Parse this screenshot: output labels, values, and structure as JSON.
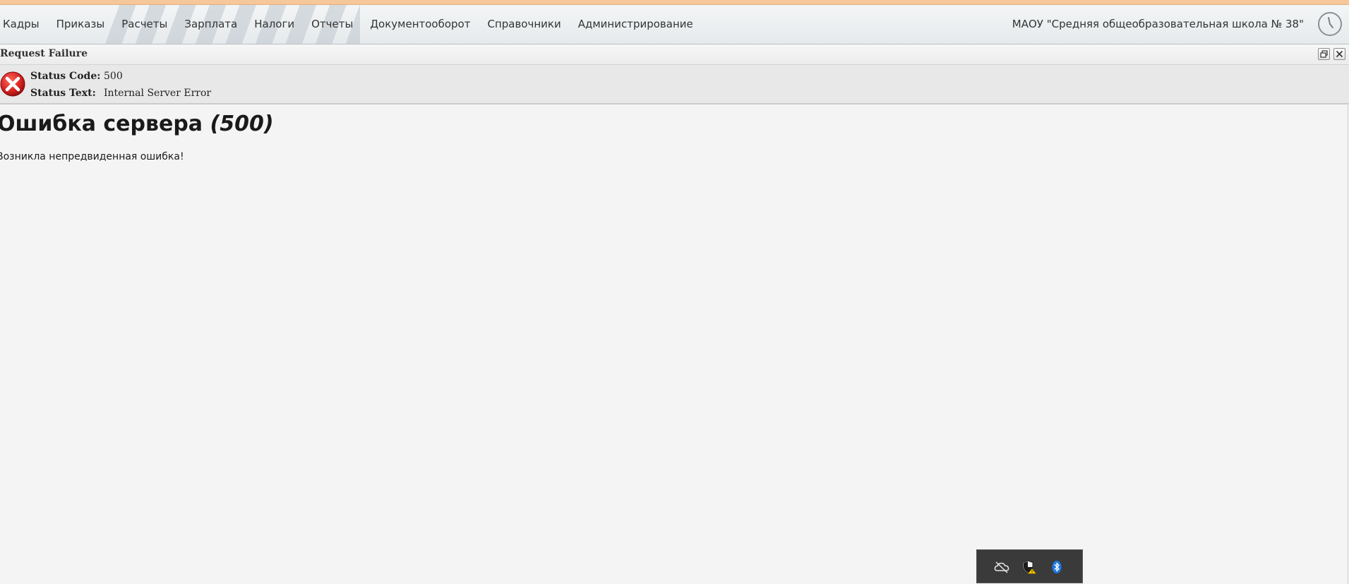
{
  "menu": {
    "items": [
      {
        "label": "Кадры"
      },
      {
        "label": "Приказы"
      },
      {
        "label": "Расчеты"
      },
      {
        "label": "Зарплата"
      },
      {
        "label": "Налоги"
      },
      {
        "label": "Отчеты"
      },
      {
        "label": "Документооборот"
      },
      {
        "label": "Справочники"
      },
      {
        "label": "Администрирование"
      }
    ],
    "org_name": "МАОУ \"Средняя общеобразовательная школа № 38\"",
    "clock_icon": "clock-icon"
  },
  "panel": {
    "title": "Request Failure",
    "restore_icon": "restore-window-icon",
    "close_icon": "close-icon"
  },
  "status": {
    "icon": "error-icon",
    "code_label": "Status Code:",
    "code_value": "500",
    "text_label": "Status Text:",
    "text_value": "Internal Server Error"
  },
  "content": {
    "title": "Ошибка сервера",
    "title_code": "(500)",
    "message": "Возникла непредвиденная ошибка!"
  },
  "tray": {
    "icons": [
      "cloud-offline-icon",
      "security-shield-warning-icon",
      "bluetooth-icon"
    ]
  },
  "colors": {
    "top_stripe": "#f6c79a",
    "error_red": "#d42020",
    "bluetooth_blue": "#1e78e6"
  }
}
